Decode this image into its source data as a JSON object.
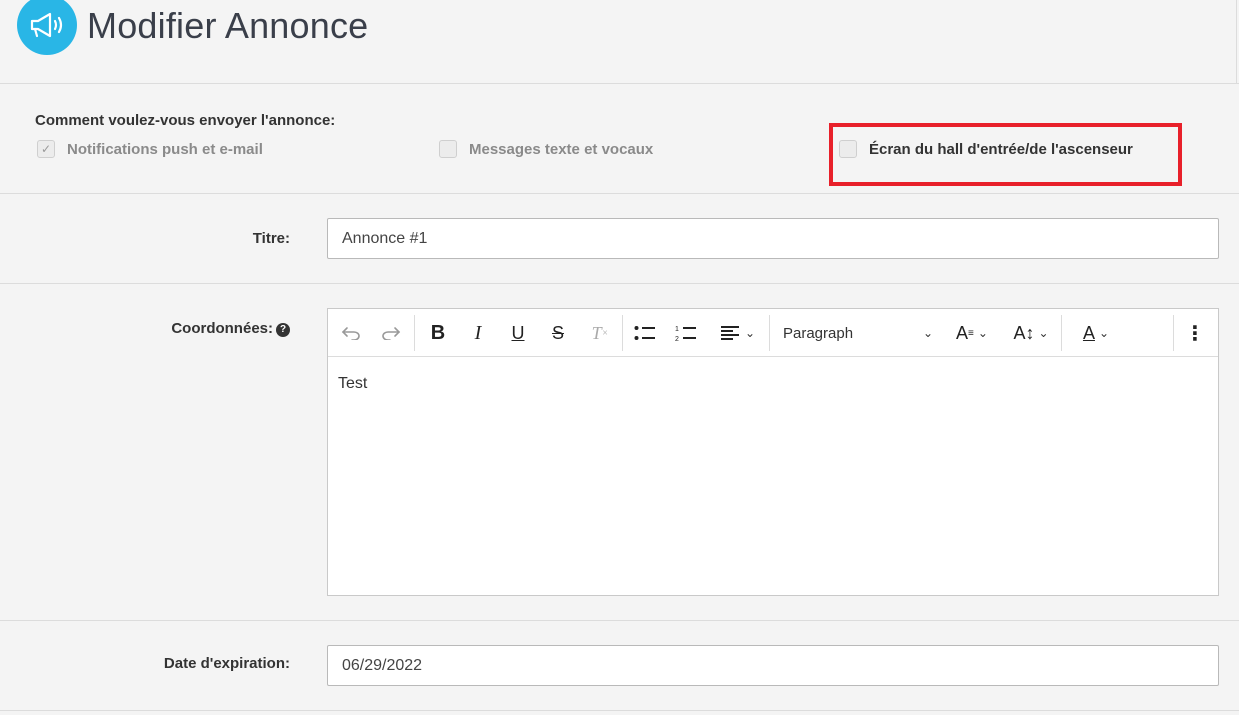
{
  "header": {
    "title": "Modifier Annonce",
    "logo_icon": "megaphone-icon",
    "accent": "#29b6e6"
  },
  "send": {
    "label": "Comment voulez-vous envoyer l'annonce:",
    "options": [
      {
        "label": "Notifications push et e-mail",
        "checked": true,
        "disabled": true
      },
      {
        "label": "Messages texte et vocaux",
        "checked": false,
        "disabled": true
      },
      {
        "label": "Écran du hall d'entrée/de l'ascenseur",
        "checked": false,
        "disabled": false
      }
    ],
    "highlight_color": "#e8202a"
  },
  "title_field": {
    "label": "Titre:",
    "value": "Annonce #1"
  },
  "details_field": {
    "label": "Coordonnées:",
    "help": "?",
    "toolbar": {
      "block_format": "Paragraph",
      "buttons": [
        "undo-icon",
        "redo-icon",
        "bold-icon",
        "italic-icon",
        "underline-icon",
        "strikethrough-icon",
        "clear-format-icon",
        "bullet-list-icon",
        "numbered-list-icon",
        "align-icon",
        "font-family-icon",
        "font-size-icon",
        "text-color-icon",
        "more-icon"
      ]
    },
    "content": "Test"
  },
  "expiry_field": {
    "label": "Date d'expiration:",
    "value": "06/29/2022"
  }
}
